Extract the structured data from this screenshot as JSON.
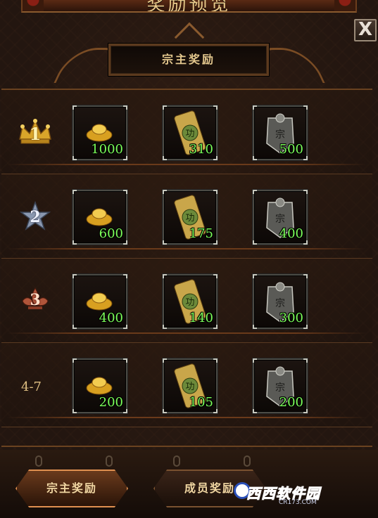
{
  "window": {
    "title": "奖励预览"
  },
  "header": {
    "close_label": "X",
    "section_title": "宗主奖励"
  },
  "rows": [
    {
      "rank": "1",
      "rank_style": "crown-gold",
      "rewards": [
        {
          "item": "gold-ingot-icon",
          "qty": "1000"
        },
        {
          "item": "merit-token-icon",
          "qty": "310"
        },
        {
          "item": "silver-plaque-icon",
          "qty": "500"
        }
      ]
    },
    {
      "rank": "2",
      "rank_style": "star-silver",
      "rewards": [
        {
          "item": "gold-ingot-icon",
          "qty": "600"
        },
        {
          "item": "merit-token-icon",
          "qty": "175"
        },
        {
          "item": "silver-plaque-icon",
          "qty": "400"
        }
      ]
    },
    {
      "rank": "3",
      "rank_style": "fleur-bronze",
      "rewards": [
        {
          "item": "gold-ingot-icon",
          "qty": "400"
        },
        {
          "item": "merit-token-icon",
          "qty": "140"
        },
        {
          "item": "silver-plaque-icon",
          "qty": "300"
        }
      ]
    },
    {
      "rank": "4-7",
      "rank_style": "text",
      "rewards": [
        {
          "item": "gold-ingot-icon",
          "qty": "200"
        },
        {
          "item": "merit-token-icon",
          "qty": "105"
        },
        {
          "item": "silver-plaque-icon",
          "qty": "200"
        }
      ]
    }
  ],
  "tabs": [
    {
      "label": "宗主奖励",
      "active": true
    },
    {
      "label": "成员奖励",
      "active": false
    }
  ],
  "watermark": {
    "main": "西西软件园",
    "sub": "CR173.COM"
  },
  "colors": {
    "gold": "#e4c88e",
    "quantity": "#7cff5a",
    "panel": "#231610"
  }
}
